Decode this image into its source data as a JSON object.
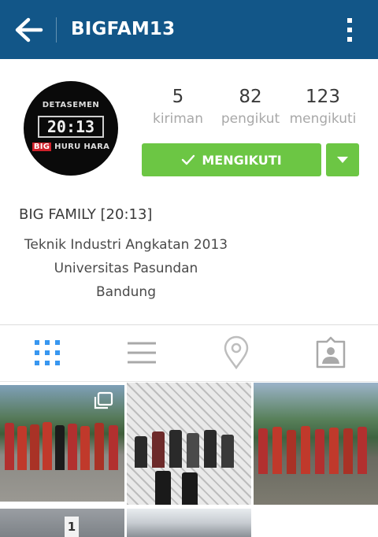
{
  "header": {
    "title": "BIGFAM13",
    "bg": "#125688",
    "icons": [
      "back-arrow-icon",
      "more-vertical-icon"
    ]
  },
  "profile": {
    "avatar_text": {
      "top": "DETASEMEN",
      "middle": "20:13",
      "bottom_red": "BIG",
      "bottom": "HURU HARA"
    },
    "stats": [
      {
        "value": "5",
        "label": "kiriman"
      },
      {
        "value": "82",
        "label": "pengikut"
      },
      {
        "value": "123",
        "label": "mengikuti"
      }
    ],
    "follow_label": "MENGIKUTI",
    "follow_color": "#6cc644",
    "name": "BIG FAMILY [20:13]",
    "bio": [
      "Teknik Industri Angkatan 2013",
      "Universitas Pasundan",
      "Bandung"
    ]
  },
  "tabs": [
    {
      "icon": "grid-view-icon",
      "active": true,
      "color": "#3897f0"
    },
    {
      "icon": "list-view-icon",
      "active": false
    },
    {
      "icon": "map-pin-icon",
      "active": false
    },
    {
      "icon": "tagged-photos-icon",
      "active": false
    }
  ],
  "grid": {
    "overlay_icon": "multiple-photos-icon",
    "sign_text": "1"
  }
}
